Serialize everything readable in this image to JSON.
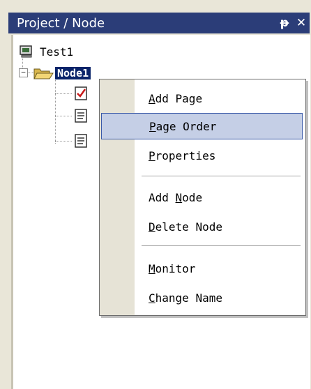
{
  "window": {
    "title": "Project / Node",
    "pin_glyph": "ᵽ",
    "close_glyph": "✕"
  },
  "tree": {
    "root": {
      "label": "Test1",
      "icon": "computer-icon"
    },
    "node": {
      "label": "Node1",
      "icon": "folder-open-icon",
      "expander": "−"
    },
    "children": [
      {
        "label": "",
        "icon": "checked-page-icon"
      },
      {
        "label": "",
        "icon": "page-icon"
      },
      {
        "label": "",
        "icon": "page-icon"
      }
    ]
  },
  "context_menu": {
    "items": [
      {
        "pre": "",
        "key": "A",
        "post": "dd Page"
      },
      {
        "pre": "",
        "key": "P",
        "post": "age Order",
        "highlighted": true
      },
      {
        "pre": "",
        "key": "P",
        "post": "roperties"
      },
      {
        "pre": "Add ",
        "key": "N",
        "post": "ode"
      },
      {
        "pre": "",
        "key": "D",
        "post": "elete Node"
      },
      {
        "pre": "",
        "key": "M",
        "post": "onitor"
      },
      {
        "pre": "",
        "key": "C",
        "post": "hange Name"
      }
    ]
  },
  "colors": {
    "titlebar": "#2b3d78",
    "selection": "#0a246a",
    "menu_highlight": "#c5cfe6"
  }
}
